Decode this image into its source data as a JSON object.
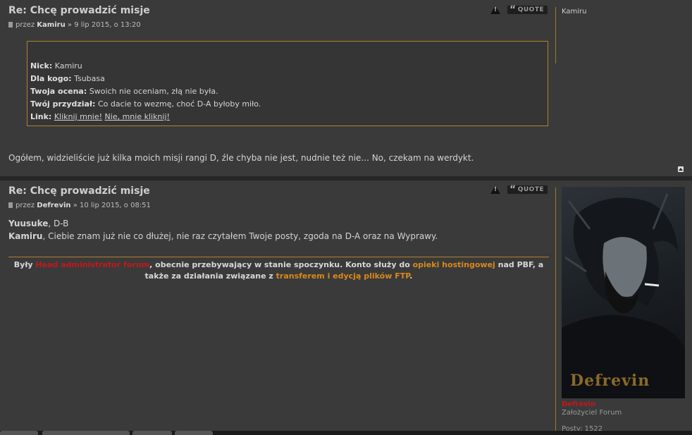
{
  "post1": {
    "title": "Re: Chcę prowadzić misje",
    "by_prefix": "przez",
    "author": "Kamiru",
    "date": "» 9 lip 2015, o 13:20",
    "quote_label": "QUOTE",
    "form": {
      "nick_label": "Nick:",
      "nick_value": "Kamiru",
      "for_label": "Dla kogo:",
      "for_value": "Tsubasa",
      "rating_label": "Twoja ocena:",
      "rating_value": "Swoich nie oceniam, złą nie była.",
      "assign_label": "Twój przydział:",
      "assign_value": "Co dacie to wezmę, choć D-A byłoby miło.",
      "link_label": "Link:",
      "link1": "Kliknij mnie!",
      "link2": "Nie, mnie kliknij!"
    },
    "body": "Ogółem, widzieliście już kilka moich misji rangi D, źle chyba nie jest, nudnie też nie... No, czekam na werdykt.",
    "profile_name": "Kamiru"
  },
  "post2": {
    "title": "Re: Chcę prowadzić misje",
    "by_prefix": "przez",
    "author": "Defrevin",
    "date": "» 10 lip 2015, o 08:51",
    "quote_label": "QUOTE",
    "line1_name": "Yuusuke",
    "line1_rest": ", D-B",
    "line2_name": "Kamiru",
    "line2_rest": ", Ciebie znam już nie co dłużej, nie raz czytałem Twoje posty, zgoda na D-A oraz na Wyprawy.",
    "sig": {
      "p1": "Były ",
      "role": "Head administrator forum",
      "p2": ", obecnie przebywający w stanie spoczynku. Konto służy do ",
      "hosting": "opieki hostingowej",
      "p3": " nad PBF, a",
      "p4": "także za działania związane z ",
      "ftp": "transferem i edycją plików FTP",
      "p5": "."
    },
    "avatar_text": "Defrevin",
    "profile_name": "Defrevin",
    "profile_rank": "Założyciel Forum",
    "posts_label": "Posty: 1522"
  }
}
